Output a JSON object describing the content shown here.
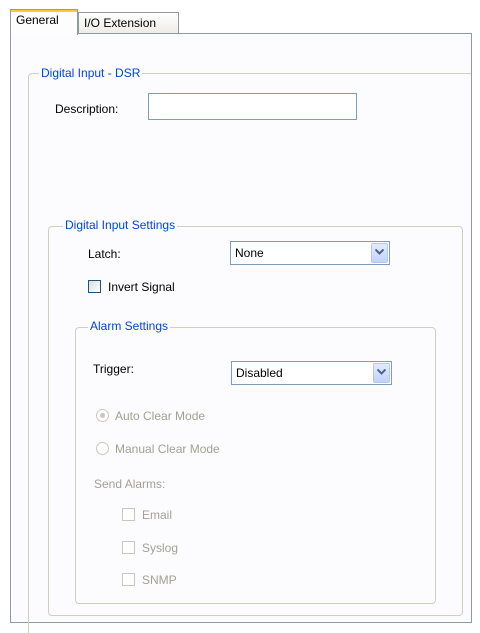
{
  "tabs": [
    {
      "label": "General",
      "selected": true
    },
    {
      "label": "I/O Extension",
      "selected": false
    }
  ],
  "digital_input_group": {
    "title": "Digital Input - DSR",
    "description_label": "Description:",
    "description_value": ""
  },
  "settings_group": {
    "title": "Digital Input Settings",
    "latch_label": "Latch:",
    "latch_value": "None",
    "invert_label": "Invert Signal",
    "invert_checked": false
  },
  "alarm_group": {
    "title": "Alarm Settings",
    "trigger_label": "Trigger:",
    "trigger_value": "Disabled",
    "auto_clear_label": "Auto Clear Mode",
    "auto_clear_selected": true,
    "manual_clear_label": "Manual Clear Mode",
    "manual_clear_selected": false,
    "send_alarms_label": "Send Alarms:",
    "email_label": "Email",
    "syslog_label": "Syslog",
    "snmp_label": "SNMP"
  },
  "colors": {
    "group_title": "#0046d5",
    "disabled_text": "#a1a192",
    "tab_highlight": "#ffc83c"
  },
  "icons": {
    "dropdown": "chevron-down-icon"
  }
}
